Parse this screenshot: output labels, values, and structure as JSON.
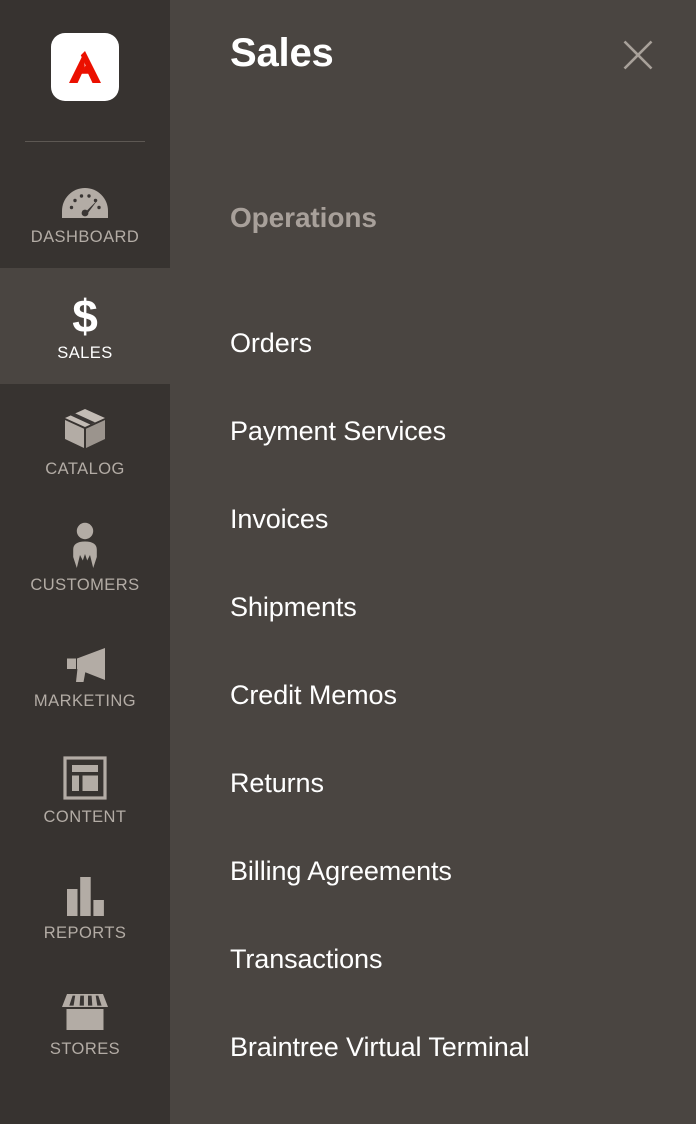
{
  "colors": {
    "rail_bg": "#373330",
    "panel_bg": "#4a4541",
    "accent_red": "#eb1000",
    "label_muted": "#b3aca5",
    "section_heading": "#a8a09a",
    "text_white": "#ffffff",
    "divider": "#5d5853",
    "icon_fill": "#b3aca5"
  },
  "sidebar": {
    "logo": {
      "name": "adobe-commerce-logo",
      "tile_color": "#ffffff",
      "mark_color": "#eb1000"
    },
    "items": [
      {
        "id": "dashboard",
        "label": "DASHBOARD",
        "icon": "dashboard-gauge-icon",
        "active": false
      },
      {
        "id": "sales",
        "label": "SALES",
        "icon": "dollar-sign-icon",
        "active": true
      },
      {
        "id": "catalog",
        "label": "CATALOG",
        "icon": "box-icon",
        "active": false
      },
      {
        "id": "customers",
        "label": "CUSTOMERS",
        "icon": "person-icon",
        "active": false
      },
      {
        "id": "marketing",
        "label": "MARKETING",
        "icon": "megaphone-icon",
        "active": false
      },
      {
        "id": "content",
        "label": "CONTENT",
        "icon": "page-layout-icon",
        "active": false
      },
      {
        "id": "reports",
        "label": "REPORTS",
        "icon": "bar-chart-icon",
        "active": false
      },
      {
        "id": "stores",
        "label": "STORES",
        "icon": "storefront-icon",
        "active": false
      }
    ]
  },
  "panel": {
    "title": "Sales",
    "close_icon": "close-x-icon",
    "sections": [
      {
        "heading": "Operations",
        "items": [
          {
            "label": "Orders"
          },
          {
            "label": "Payment Services"
          },
          {
            "label": "Invoices"
          },
          {
            "label": "Shipments"
          },
          {
            "label": "Credit Memos"
          },
          {
            "label": "Returns"
          },
          {
            "label": "Billing Agreements"
          },
          {
            "label": "Transactions"
          },
          {
            "label": "Braintree Virtual Terminal"
          }
        ]
      }
    ]
  }
}
